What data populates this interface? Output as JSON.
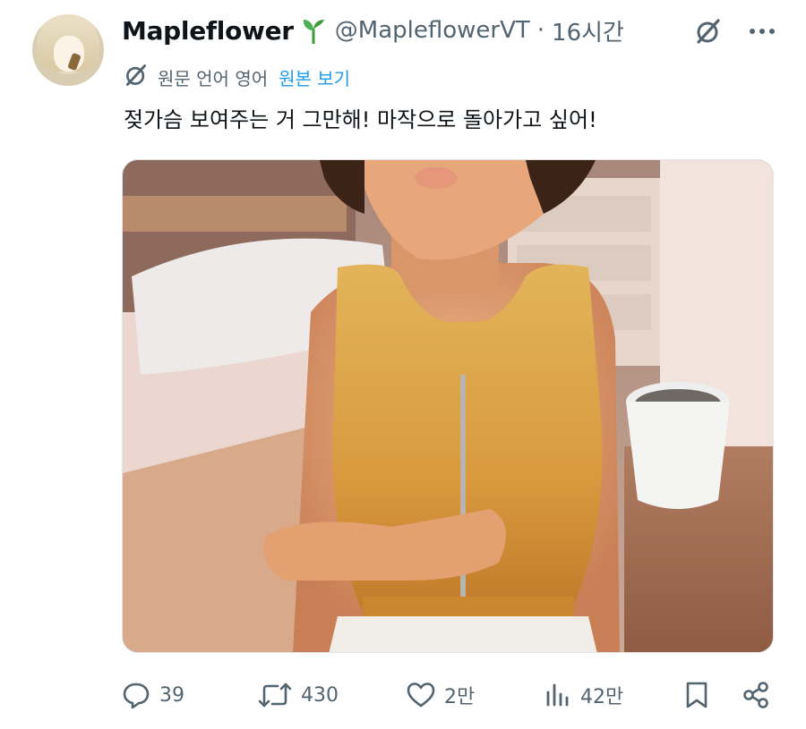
{
  "author": {
    "display_name": "Mapleflower",
    "handle": "@MapleflowerVT",
    "separator": "·",
    "time": "16시간"
  },
  "translation": {
    "label": "원문 언어 영어",
    "link": "원본 보기"
  },
  "tweet": {
    "text": "젖가슴 보여주는 거 그만해! 마작으로 돌아가고 싶어!"
  },
  "media": {
    "kind": "3d-render-image"
  },
  "actions": {
    "reply_count": "39",
    "retweet_count": "430",
    "like_count": "2만",
    "view_count": "42만"
  },
  "colors": {
    "text": "#0f1419",
    "muted": "#536471",
    "link": "#1d9bf0",
    "badge_green": "#3f9b3a"
  },
  "icons": [
    "sprout-badge-icon",
    "grok-icon",
    "more-icon",
    "translate-icon",
    "reply-icon",
    "retweet-icon",
    "like-icon",
    "views-icon",
    "bookmark-icon",
    "share-icon"
  ]
}
